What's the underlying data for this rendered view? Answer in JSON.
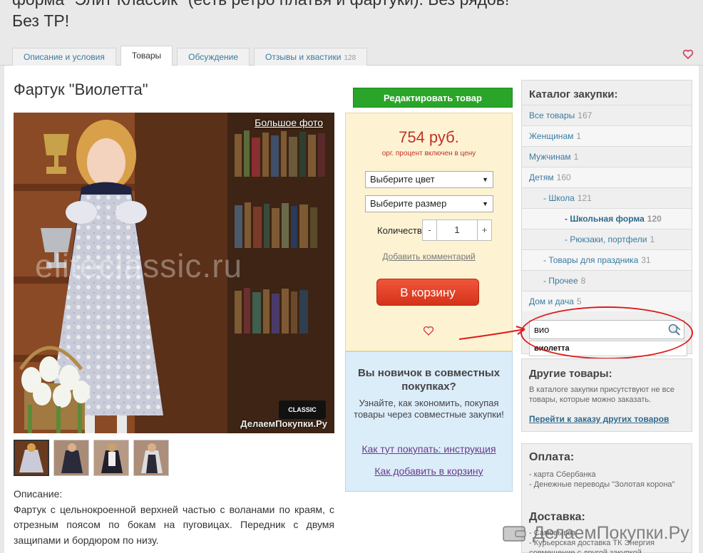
{
  "header": {
    "title": "форма \"Элит Классик\" (есть ретро платья и фартуки). Без рядов! Без ТР!",
    "tabs": [
      {
        "label": "Описание и условия",
        "count": ""
      },
      {
        "label": "Товары",
        "count": ""
      },
      {
        "label": "Обсуждение",
        "count": ""
      },
      {
        "label": "Отзывы и хвастики",
        "count": "128"
      }
    ],
    "active_tab": 1
  },
  "product": {
    "title": "Фартук \"Виолетта\"",
    "big_photo_label": "Большое фото",
    "photo_watermark": "eliteclassic.ru",
    "photo_badge": "ДелаемПокупки.Ру",
    "classic_badge": "CLASSIC",
    "description_label": "Описание:",
    "description": "Фартук с цельнокроенной верхней частью с воланами по краям, с отрезным поясом по бокам на пуговицах. Передник с двумя защипами и бордюром по низу."
  },
  "buy": {
    "edit_button": "Редактировать товар",
    "price": "754 руб.",
    "price_note": "орг. процент включен в цену",
    "color_select": "Выберите цвет",
    "size_select": "Выберите размер",
    "qty_label": "Количество:",
    "qty_value": "1",
    "qty_minus": "-",
    "qty_plus": "+",
    "add_comment": "Добавить комментарий",
    "cart_button": "В корзину"
  },
  "newbie": {
    "title": "Вы новичок в совместных покупках?",
    "text": "Узнайте, как экономить, покупая товары через совместные закупки!",
    "link1": "Как тут покупать: инструкция",
    "link2": "Как добавить в корзину"
  },
  "catalog": {
    "title": "Каталог закупки:",
    "items": [
      {
        "label": "Все товары",
        "count": "167",
        "indent": 0
      },
      {
        "label": "Женщинам",
        "count": "1",
        "indent": 0
      },
      {
        "label": "Мужчинам",
        "count": "1",
        "indent": 0
      },
      {
        "label": "Детям",
        "count": "160",
        "indent": 0
      },
      {
        "label": "- Школа",
        "count": "121",
        "indent": 1
      },
      {
        "label": "- Школьная форма",
        "count": "120",
        "indent": 2
      },
      {
        "label": "- Рюкзаки, портфели",
        "count": "1",
        "indent": 2
      },
      {
        "label": "- Товары для праздника",
        "count": "31",
        "indent": 1
      },
      {
        "label": "- Прочее",
        "count": "8",
        "indent": 1
      },
      {
        "label": "Дом и дача",
        "count": "5",
        "indent": 0
      }
    ],
    "search_value": "вио",
    "suggestion": "виолетта"
  },
  "other": {
    "title": "Другие товары:",
    "text": "В каталоге закупки присутствуют не все товары, которые можно заказать.",
    "link": "Перейти к заказу других товаров"
  },
  "payment": {
    "title": "Оплата:",
    "items": [
      "- карта Сбербанка",
      "- Денежные переводы \"Золотая корона\""
    ]
  },
  "delivery": {
    "title": "Доставка:",
    "items": [
      "- Самовывоз",
      "- Курьерская доставка ТК Энергия совмещение с другой закупкой"
    ]
  },
  "watermark": "ДелаемПокупки.Ру",
  "colors": {
    "accent_green": "#2aa52a",
    "price_red": "#c0312b",
    "cart_red": "#e04426",
    "link_blue": "#3a7ba0",
    "annotation_red": "#e01a1a"
  },
  "icons": {
    "heart": "heart-icon",
    "search": "search-icon",
    "clear": "clear-icon",
    "arrow": "annotation-arrow"
  }
}
